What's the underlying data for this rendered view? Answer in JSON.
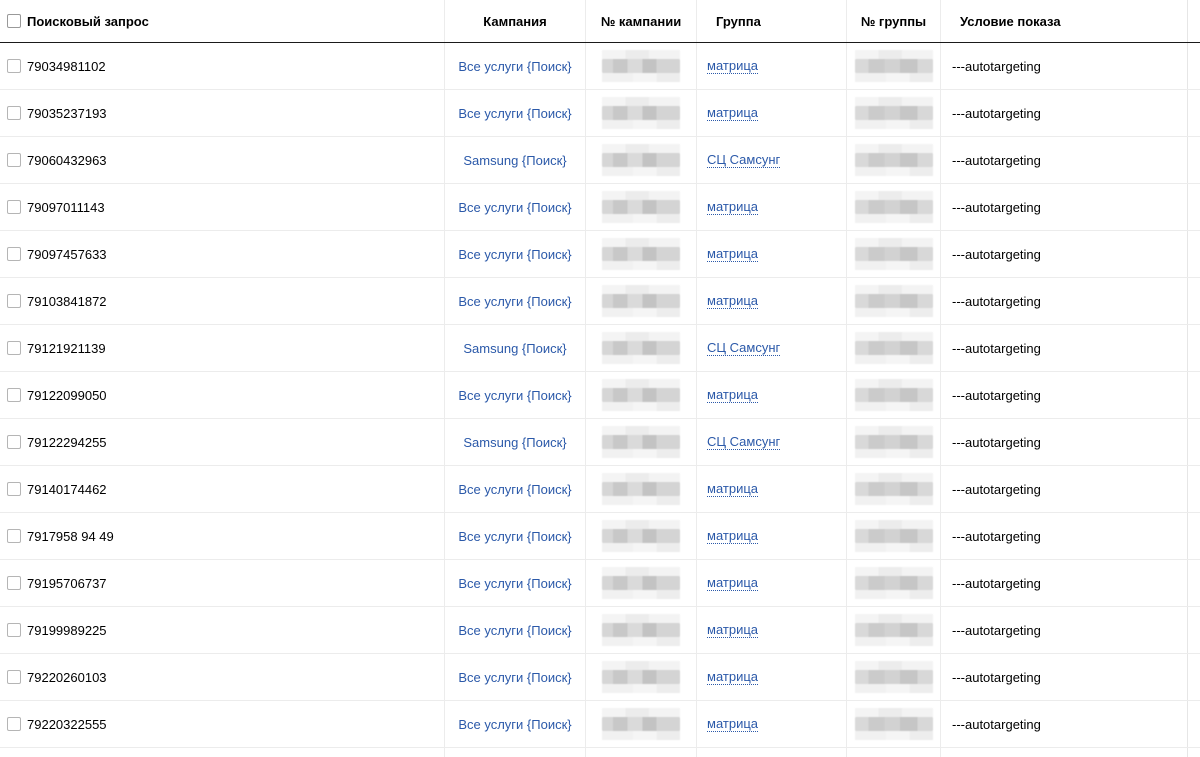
{
  "header": {
    "query": "Поисковый запрос",
    "campaign": "Кампания",
    "campaign_num": "№ кампании",
    "group": "Группа",
    "group_num": "№ группы",
    "condition": "Условие показа"
  },
  "rows": [
    {
      "query": "79034981102",
      "campaign": "Все услуги {Поиск}",
      "group": "матрица",
      "condition": "---autotargeting"
    },
    {
      "query": "79035237193",
      "campaign": "Все услуги {Поиск}",
      "group": "матрица",
      "condition": "---autotargeting"
    },
    {
      "query": "79060432963",
      "campaign": "Samsung {Поиск}",
      "group": "СЦ Самсунг",
      "condition": "---autotargeting"
    },
    {
      "query": "79097011143",
      "campaign": "Все услуги {Поиск}",
      "group": "матрица",
      "condition": "---autotargeting"
    },
    {
      "query": "79097457633",
      "campaign": "Все услуги {Поиск}",
      "group": "матрица",
      "condition": "---autotargeting"
    },
    {
      "query": "79103841872",
      "campaign": "Все услуги {Поиск}",
      "group": "матрица",
      "condition": "---autotargeting"
    },
    {
      "query": "79121921139",
      "campaign": "Samsung {Поиск}",
      "group": "СЦ Самсунг",
      "condition": "---autotargeting"
    },
    {
      "query": "79122099050",
      "campaign": "Все услуги {Поиск}",
      "group": "матрица",
      "condition": "---autotargeting"
    },
    {
      "query": "79122294255",
      "campaign": "Samsung {Поиск}",
      "group": "СЦ Самсунг",
      "condition": "---autotargeting"
    },
    {
      "query": "79140174462",
      "campaign": "Все услуги {Поиск}",
      "group": "матрица",
      "condition": "---autotargeting"
    },
    {
      "query": "7917958 94 49",
      "campaign": "Все услуги {Поиск}",
      "group": "матрица",
      "condition": "---autotargeting"
    },
    {
      "query": "79195706737",
      "campaign": "Все услуги {Поиск}",
      "group": "матрица",
      "condition": "---autotargeting"
    },
    {
      "query": "79199989225",
      "campaign": "Все услуги {Поиск}",
      "group": "матрица",
      "condition": "---autotargeting"
    },
    {
      "query": "79220260103",
      "campaign": "Все услуги {Поиск}",
      "group": "матрица",
      "condition": "---autotargeting"
    },
    {
      "query": "79220322555",
      "campaign": "Все услуги {Поиск}",
      "group": "матрица",
      "condition": "---autotargeting"
    }
  ],
  "colors": {
    "link": "#2b59a9",
    "header_border": "#1a1a1a",
    "row_border": "#ececec",
    "redacted": "#cfcfcf"
  }
}
